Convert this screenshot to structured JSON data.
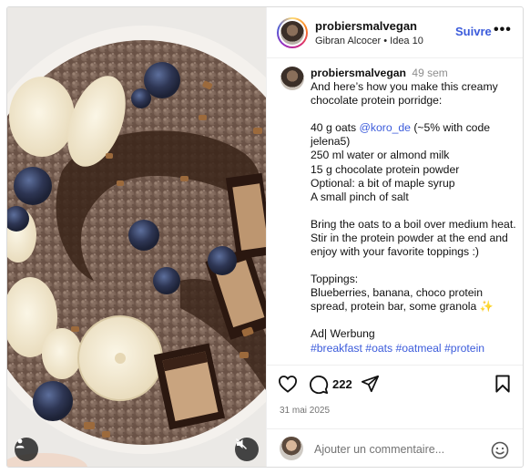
{
  "header": {
    "username": "probiersmalvegan",
    "subtitle_name": "Gibran Alcocer",
    "subtitle_separator": "•",
    "subtitle_track": "Idea 10",
    "follow_label": "Suivre",
    "more_label": "•••"
  },
  "caption": {
    "username": "probiersmalvegan",
    "time": "49 sem",
    "intro": "And here’s how you make this creamy chocolate protein porridge:",
    "oats_prefix": "40 g oats ",
    "oats_mention": "@koro_de",
    "oats_suffix": " (~5% with code jelena5)",
    "ingredient_lines": "250 ml water or almond milk\n15 g chocolate protein powder\nOptional: a bit of maple syrup\nA small pinch of salt",
    "method": "Bring the oats to a boil over medium heat. Stir in the protein powder at the end and enjoy with your favorite toppings :)",
    "toppings_title": "Toppings:",
    "toppings_text": "Blueberries, banana, choco protein spread, protein bar, some granola ✨",
    "ad_label": "Ad| Werbung",
    "hashtags": "#breakfast #oats #oatmeal #protein"
  },
  "actions": {
    "comment_count": "222",
    "date": "31 mai 2025"
  },
  "comment_box": {
    "placeholder": "Ajouter un commentaire..."
  },
  "colors": {
    "link_blue": "#3b5bdb",
    "muted_gray": "#737373",
    "border": "#dbdbdb"
  },
  "icons": [
    "user-tag-icon",
    "mute-icon",
    "heart-icon",
    "comment-icon",
    "share-icon",
    "bookmark-icon",
    "emoji-icon"
  ]
}
